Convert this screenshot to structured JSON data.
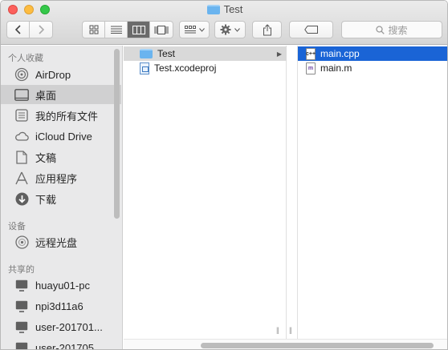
{
  "window": {
    "title": "Test"
  },
  "toolbar": {
    "search_placeholder": "搜索",
    "view_modes": [
      "icon-view",
      "list-view",
      "column-view",
      "gallery-view"
    ],
    "active_view": "column-view"
  },
  "sidebar": {
    "sections": [
      {
        "label": "个人收藏",
        "items": [
          {
            "label": "AirDrop",
            "icon": "airdrop-icon"
          },
          {
            "label": "桌面",
            "icon": "desktop-icon",
            "selected": true
          },
          {
            "label": "我的所有文件",
            "icon": "all-files-icon"
          },
          {
            "label": "iCloud Drive",
            "icon": "cloud-icon"
          },
          {
            "label": "文稿",
            "icon": "documents-icon"
          },
          {
            "label": "应用程序",
            "icon": "applications-icon"
          },
          {
            "label": "下载",
            "icon": "downloads-icon"
          }
        ]
      },
      {
        "label": "设备",
        "items": [
          {
            "label": "远程光盘",
            "icon": "disc-icon"
          }
        ]
      },
      {
        "label": "共享的",
        "items": [
          {
            "label": "huayu01-pc",
            "icon": "monitor-icon"
          },
          {
            "label": "npi3d11a6",
            "icon": "monitor-icon"
          },
          {
            "label": "user-201701...",
            "icon": "monitor-icon"
          },
          {
            "label": "user-201705...",
            "icon": "monitor-icon"
          }
        ]
      }
    ]
  },
  "columns": [
    {
      "items": [
        {
          "label": "Test",
          "kind": "folder",
          "selected": "grey",
          "has_children": true
        },
        {
          "label": "Test.xcodeproj",
          "kind": "xcodeproj"
        }
      ]
    },
    {
      "items": [
        {
          "label": "main.cpp",
          "kind": "cpp",
          "badge": "c++",
          "selected": "blue"
        },
        {
          "label": "main.m",
          "kind": "objc",
          "badge": "m"
        }
      ]
    }
  ],
  "colors": {
    "selection_blue": "#1a64d6",
    "folder_blue": "#6ab4ef"
  }
}
